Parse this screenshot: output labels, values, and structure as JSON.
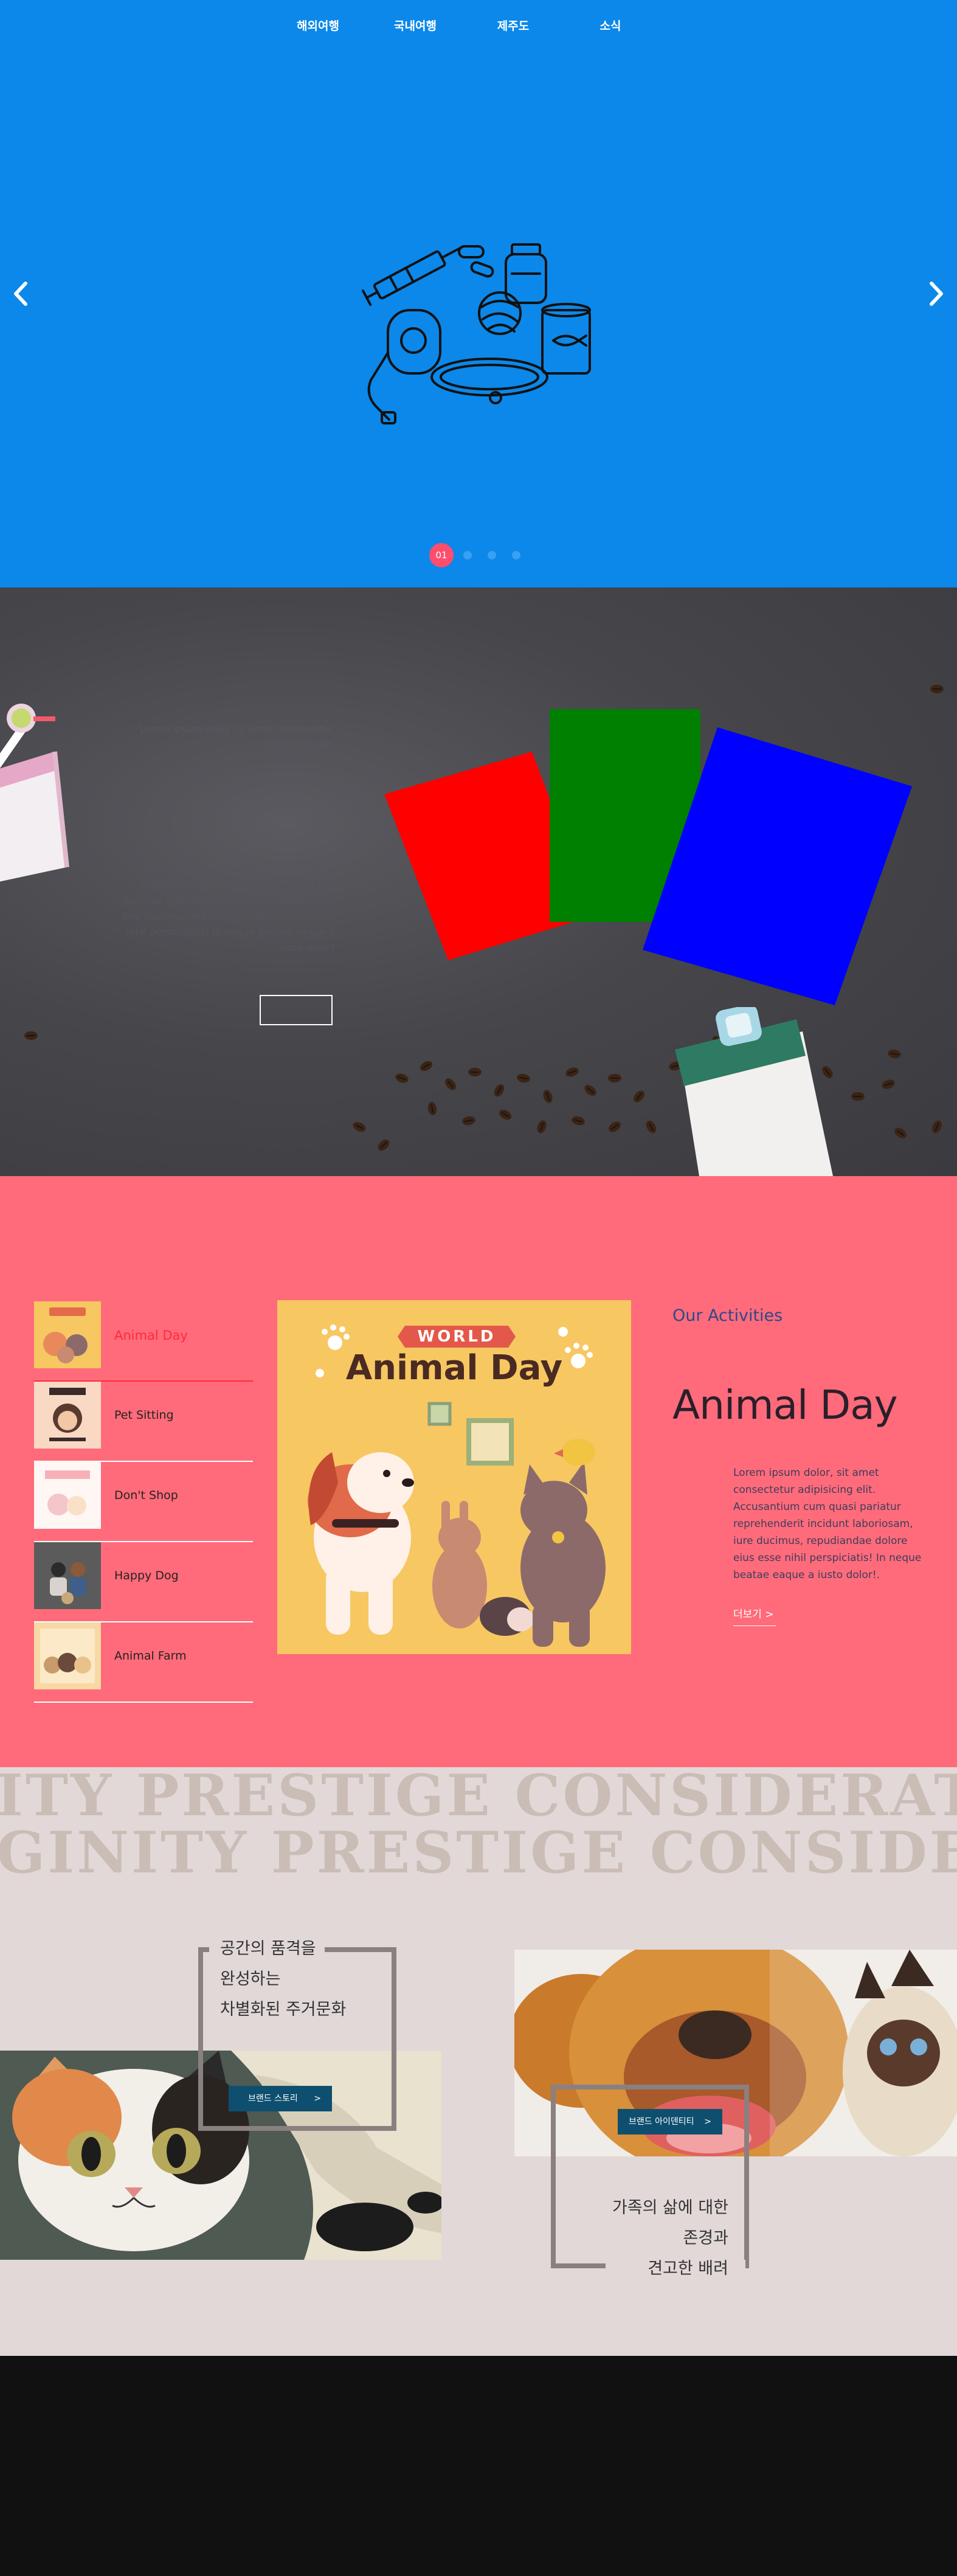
{
  "nav": {
    "items": [
      {
        "label": "해외여행"
      },
      {
        "label": "국내여행"
      },
      {
        "label": "제주도"
      },
      {
        "label": "소식"
      }
    ]
  },
  "hero": {
    "slide_number": "01",
    "background": "#0b88ea",
    "icon_names": [
      "chevron-left-icon",
      "chevron-right-icon",
      "pet-supplies-illustration"
    ]
  },
  "promo": {
    "text_top": "Lorem ipsum dolor sit amet consectetur adipisicing elit.",
    "text_body": "Lorem ipsum dolor sit amet consectetur adipisicing elit. Accusantium cum quasi pariatur reprehenderit incidunt laboriosam, iure ducimus, repudiandae dolore eius esse nihil perspiciatis! In neque beatae eaque a iusto dolor!",
    "card_colors": [
      "#ff0000",
      "#008000",
      "#0000ff"
    ]
  },
  "activities": {
    "heading": "Our Activities",
    "title": "Animal Day",
    "description": "Lorem ipsum dolor, sit amet consectetur adipisicing elit. Accusantium cum quasi pariatur reprehenderit incidunt laboriosam, iure ducimus, repudiandae dolore eius esse nihil perspiciatis! In neque beatae eaque a iusto dolor!.",
    "more_label": "더보기 >",
    "items": [
      {
        "label": "Animal Day"
      },
      {
        "label": "Pet Sitting"
      },
      {
        "label": "Don't Shop"
      },
      {
        "label": "Happy Dog"
      },
      {
        "label": "Animal Farm"
      }
    ],
    "feature": {
      "banner": "WORLD",
      "title": "Animal Day"
    },
    "accent": "#ff6b7a"
  },
  "brand": {
    "marquee_row1": "ITY   PRESTIGE   CONSIDERATIO",
    "marquee_row2": "GINITY   PRESTIGE   CONSIDERAT",
    "story": {
      "lines": [
        "공간의 품격을",
        "완성하는",
        "차별화된 주거문화"
      ],
      "button": "브랜드 스토리",
      "chevron": ">"
    },
    "identity": {
      "lines": [
        "가족의 삶에 대한",
        "존경과",
        "견고한 배려"
      ],
      "button": "브랜드 아이덴티티",
      "chevron": ">"
    }
  }
}
